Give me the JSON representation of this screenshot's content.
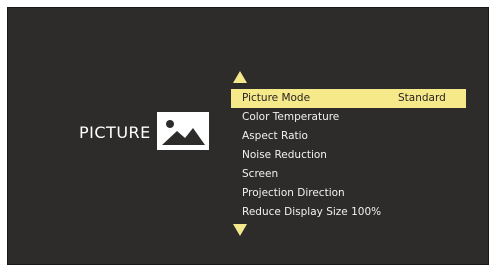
{
  "section": {
    "title": "PICTURE",
    "icon": "picture-icon"
  },
  "menu": {
    "items": [
      {
        "label": "Picture Mode",
        "value": "Standard",
        "selected": true
      },
      {
        "label": "Color Temperature",
        "value": "",
        "selected": false
      },
      {
        "label": "Aspect Ratio",
        "value": "",
        "selected": false
      },
      {
        "label": "Noise Reduction",
        "value": "",
        "selected": false
      },
      {
        "label": "Screen",
        "value": "",
        "selected": false
      },
      {
        "label": "Projection Direction",
        "value": "",
        "selected": false
      },
      {
        "label": "Reduce Display Size 100%",
        "value": "",
        "selected": false
      }
    ]
  },
  "colors": {
    "background": "#2e2b2b",
    "highlight": "#f5e98a",
    "text": "#f2f2f2"
  }
}
